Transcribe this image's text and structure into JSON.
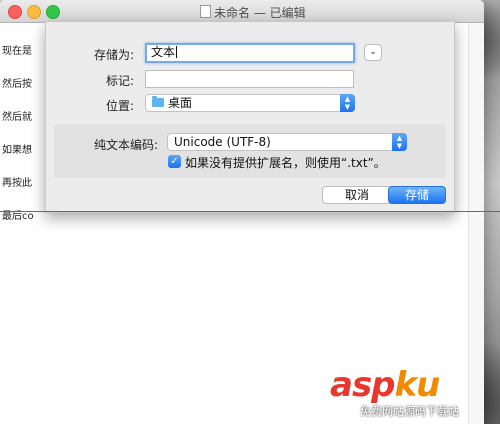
{
  "window": {
    "title": "未命名 — 已编辑",
    "doc_lines": [
      "现在是",
      "然后按",
      "然后就",
      "如果想",
      "再按此",
      "最后co"
    ]
  },
  "dialog": {
    "save_as_label": "存储为:",
    "save_as_value": "文本",
    "tags_label": "标记:",
    "tags_value": "",
    "location_label": "位置:",
    "location_value": "桌面",
    "encoding_label": "纯文本编码:",
    "encoding_value": "Unicode (UTF-8)",
    "extension_checkbox_label": "如果没有提供扩展名，则使用“.txt”。",
    "extension_checked": true,
    "cancel_label": "取消",
    "save_label": "存储"
  },
  "watermark": {
    "brand_asp": "asp",
    "brand_ku": "ku",
    "tagline": "免费网站源码下载站"
  },
  "colors": {
    "accent": "#1b73f0",
    "close": "#fc605c",
    "minimize": "#fdbc40",
    "maximize": "#34c84a"
  }
}
